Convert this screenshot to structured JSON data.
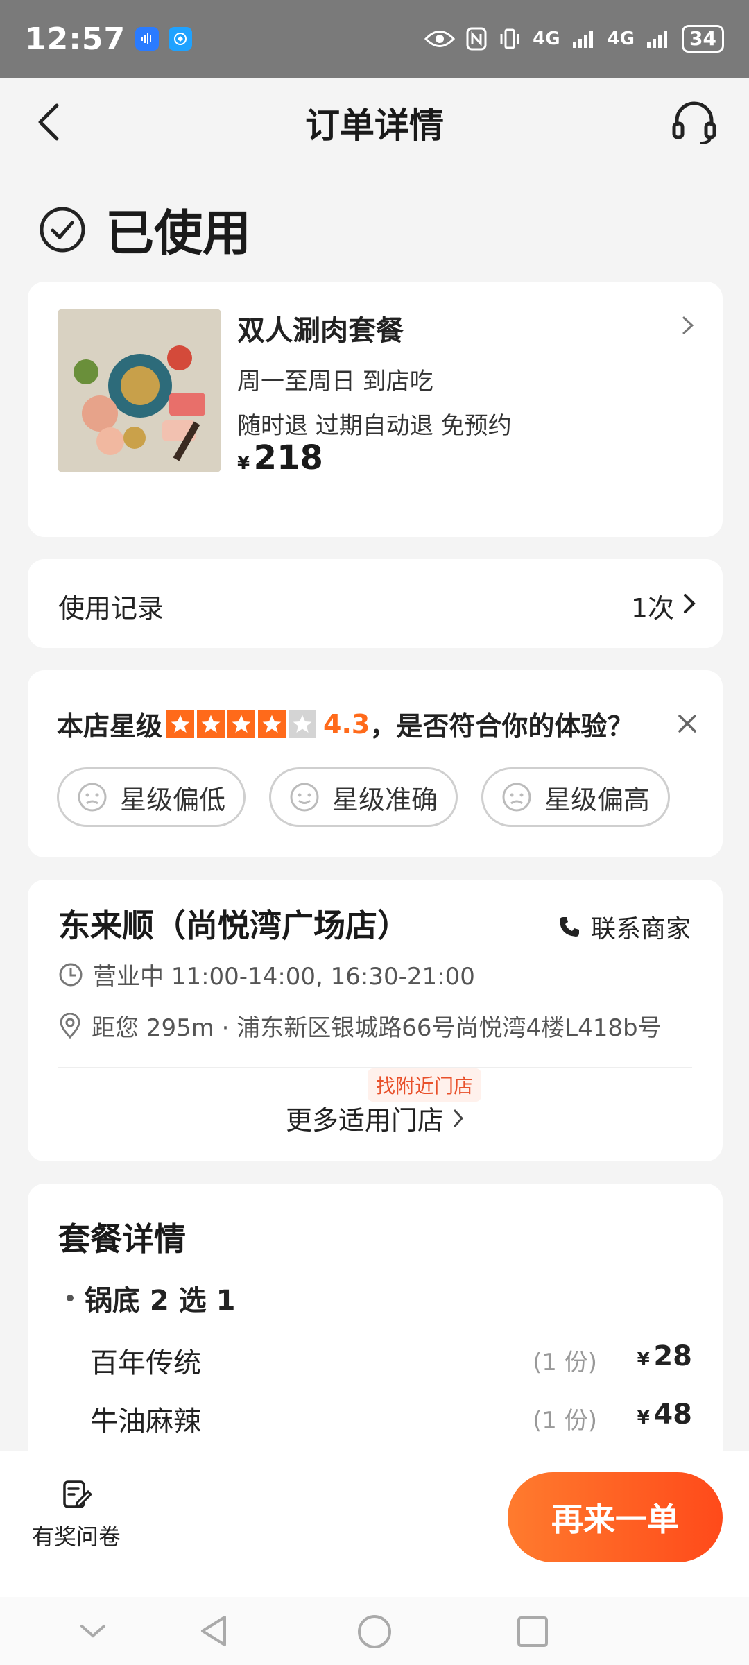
{
  "status_bar": {
    "time": "12:57",
    "network_1": "4G",
    "network_2": "4G",
    "battery": "34"
  },
  "header": {
    "title": "订单详情",
    "back_icon": "chevron-left-icon",
    "service_icon": "headset-icon"
  },
  "order_status": {
    "label": "已使用",
    "icon": "check-circle-icon"
  },
  "product": {
    "title": "双人涮肉套餐",
    "line1": "周一至周日   到店吃",
    "line2": "随时退   过期自动退   免预约",
    "currency": "¥",
    "price": "218"
  },
  "usage_record": {
    "label": "使用记录",
    "count": "1次"
  },
  "rating": {
    "prefix": "本店星级",
    "score": "4.3",
    "stars_value": 4.3,
    "question": "，是否符合你的体验？",
    "options": [
      "星级偏低",
      "星级准确",
      "星级偏高"
    ],
    "accent": "#ff6a1a"
  },
  "store": {
    "name": "东来顺（尚悦湾广场店）",
    "contact_label": "联系商家",
    "hours": "营业中 11:00-14:00, 16:30-21:00",
    "address": "距您 295m · 浦东新区银城路66号尚悦湾4楼L418b号",
    "nearby_badge": "找附近门店",
    "more_stores": "更多适用门店"
  },
  "package": {
    "title": "套餐详情",
    "group_title": "锅底 2 选 1",
    "items": [
      {
        "name": "百年传统",
        "qty": "(1 份)",
        "currency": "¥",
        "price": "28"
      },
      {
        "name": "牛油麻辣",
        "qty": "(1 份)",
        "currency": "¥",
        "price": "48"
      }
    ]
  },
  "bottom": {
    "survey_label": "有奖问卷",
    "reorder_label": "再来一单"
  }
}
